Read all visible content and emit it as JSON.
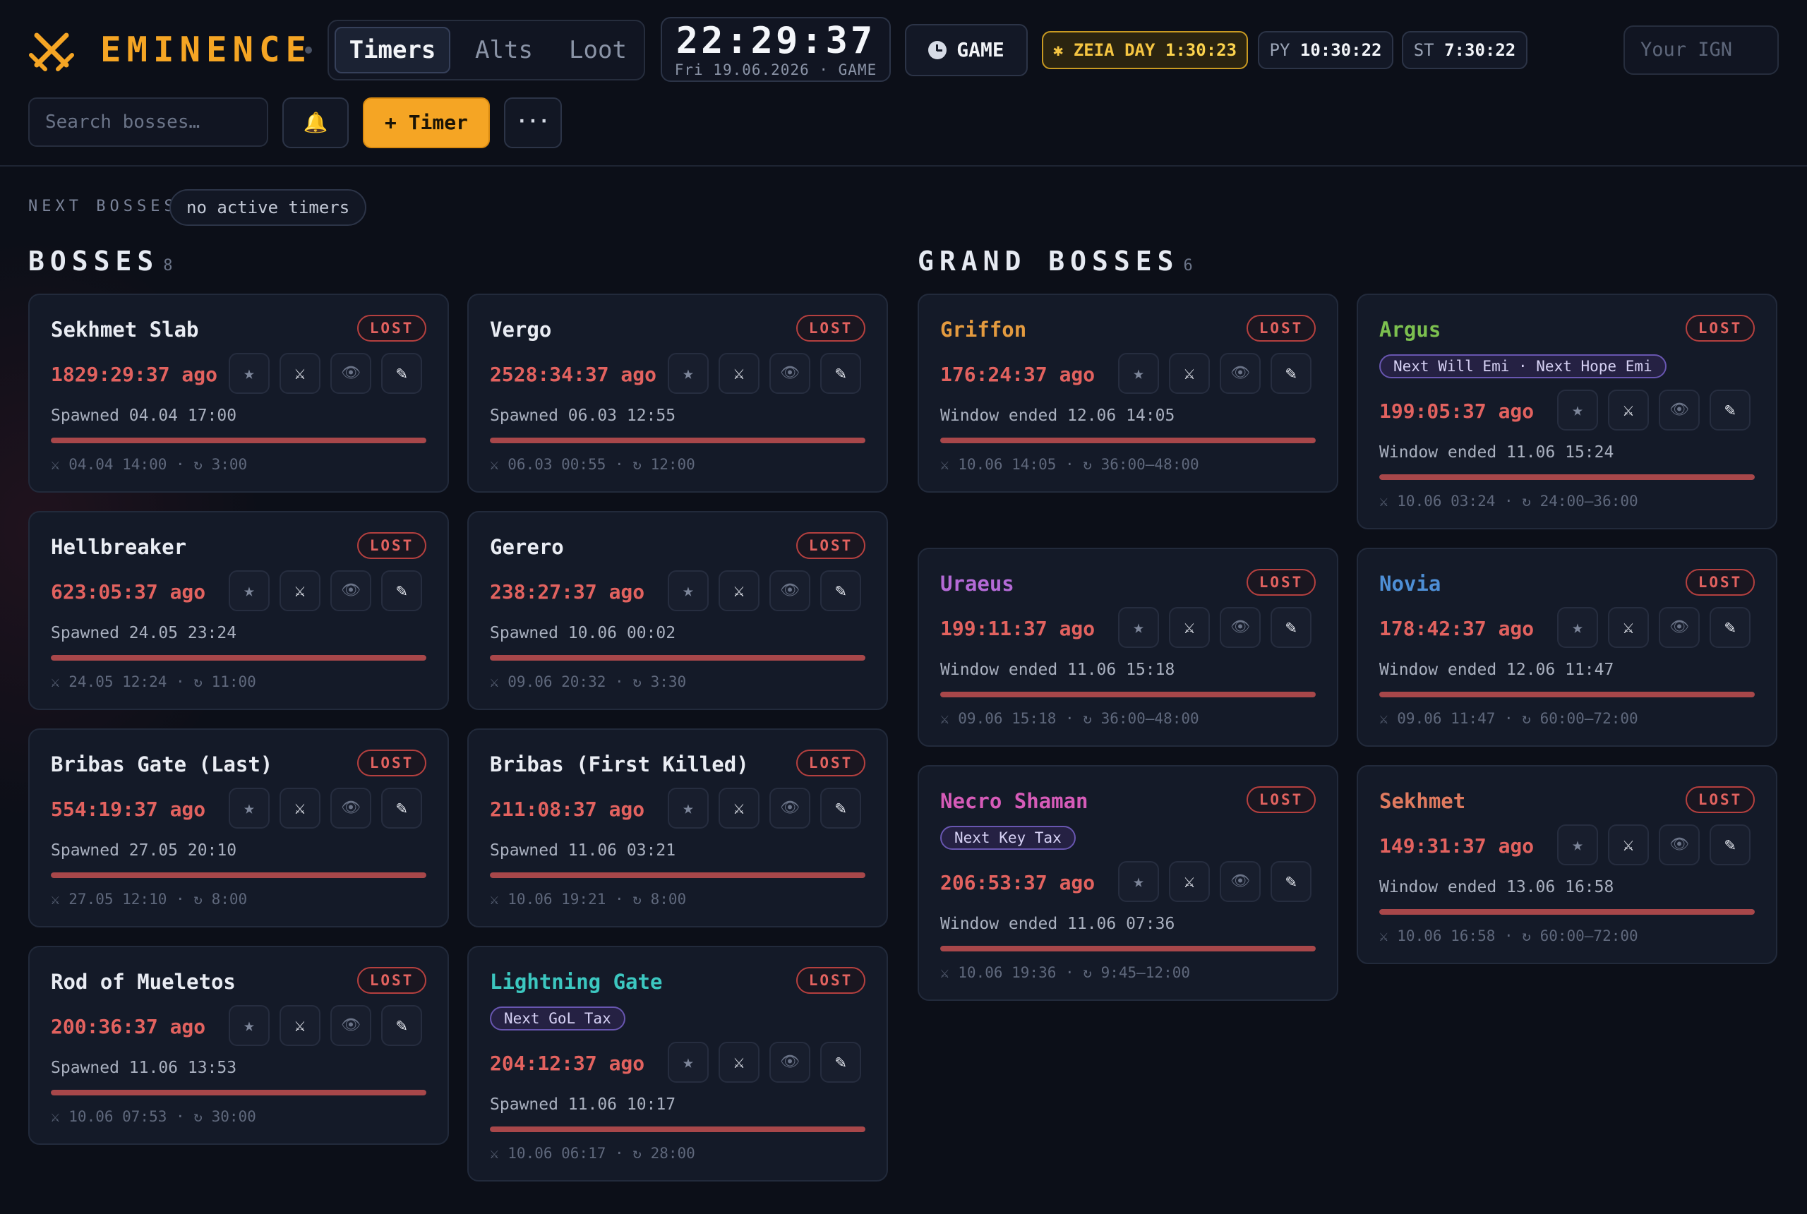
{
  "header": {
    "brand": "EMINENCE",
    "tabs": [
      "Timers",
      "Alts",
      "Loot"
    ],
    "clock_time": "22:29:37",
    "clock_date": "Fri 19.06.2026 · GAME",
    "game_icon": "clock-icon",
    "game_label": "GAME",
    "zeia_label": "✱ ZEIA DAY",
    "zeia_value": "1:30:23",
    "py_label": "PY",
    "py_value": "10:30:22",
    "st_label": "ST",
    "st_value": "7:30:22",
    "ign_placeholder": "Your IGN",
    "search_placeholder": "Search bosses…",
    "bell_icon": "🔔",
    "add_timer_label": "+ Timer",
    "more_label": "···"
  },
  "next": {
    "label": "NEXT BOSSES",
    "chip": "no active timers"
  },
  "bosses": {
    "title": "BOSSES",
    "count": "8",
    "items": [
      {
        "name": "Sekhmet Slab",
        "status": "LOST",
        "ago": "1829:29:37 ago",
        "line": "Spawned 04.04 17:00",
        "foot": "⚔ 04.04 14:00 · ↻ 3:00",
        "progress": 1.0
      },
      {
        "name": "Vergo",
        "status": "LOST",
        "ago": "2528:34:37 ago",
        "line": "Spawned 06.03 12:55",
        "foot": "⚔ 06.03 00:55 · ↻ 12:00",
        "progress": 1.0
      },
      {
        "name": "Hellbreaker",
        "status": "LOST",
        "ago": "623:05:37 ago",
        "line": "Spawned 24.05 23:24",
        "foot": "⚔ 24.05 12:24 · ↻ 11:00",
        "progress": 1.0
      },
      {
        "name": "Gerero",
        "status": "LOST",
        "ago": "238:27:37 ago",
        "line": "Spawned 10.06 00:02",
        "foot": "⚔ 09.06 20:32 · ↻ 3:30",
        "progress": 1.0
      },
      {
        "name": "Bribas Gate (Last)",
        "status": "LOST",
        "ago": "554:19:37 ago",
        "line": "Spawned 27.05 20:10",
        "foot": "⚔ 27.05 12:10 · ↻ 8:00",
        "progress": 1.0
      },
      {
        "name": "Bribas (First Killed)",
        "status": "LOST",
        "ago": "211:08:37 ago",
        "line": "Spawned 11.06 03:21",
        "foot": "⚔ 10.06 19:21 · ↻ 8:00",
        "progress": 1.0
      },
      {
        "name": "Rod of Mueletos",
        "status": "LOST",
        "ago": "200:36:37 ago",
        "line": "Spawned 11.06 13:53",
        "foot": "⚔ 10.06 07:53 · ↻ 30:00",
        "progress": 1.0
      },
      {
        "name": "Lightning Gate",
        "status": "LOST",
        "tag": "Next GoL Tax",
        "ago": "204:12:37 ago",
        "line": "Spawned 11.06 10:17",
        "foot": "⚔ 10.06 06:17 · ↻ 28:00",
        "progress": 1.0
      }
    ]
  },
  "grand": {
    "title": "GRAND BOSSES",
    "count": "6",
    "items": [
      {
        "name": "Griffon",
        "status": "LOST",
        "ago": "176:24:37 ago",
        "line": "Window ended 12.06 14:05",
        "foot": "⚔ 10.06 14:05 · ↻ 36:00–48:00",
        "progress": 1.0
      },
      {
        "name": "Argus",
        "status": "LOST",
        "tag": "Next Will Emi · Next Hope Emi",
        "ago": "199:05:37 ago",
        "line": "Window ended 11.06 15:24",
        "foot": "⚔ 10.06 03:24 · ↻ 24:00–36:00",
        "progress": 1.0
      },
      {
        "name": "Uraeus",
        "status": "LOST",
        "ago": "199:11:37 ago",
        "line": "Window ended 11.06 15:18",
        "foot": "⚔ 09.06 15:18 · ↻ 36:00–48:00",
        "progress": 1.0
      },
      {
        "name": "Novia",
        "status": "LOST",
        "ago": "178:42:37 ago",
        "line": "Window ended 12.06 11:47",
        "foot": "⚔ 09.06 11:47 · ↻ 60:00–72:00",
        "progress": 1.0
      },
      {
        "name": "Necro Shaman",
        "status": "LOST",
        "tag": "Next Key Tax",
        "ago": "206:53:37 ago",
        "line": "Window ended 11.06 07:36",
        "foot": "⚔ 10.06 19:36 · ↻ 9:45–12:00",
        "progress": 1.0
      },
      {
        "name": "Sekhmet",
        "status": "LOST",
        "ago": "149:31:37 ago",
        "line": "Window ended 13.06 16:58",
        "foot": "⚔ 10.06 16:58 · ↻ 60:00–72:00",
        "progress": 1.0
      }
    ]
  },
  "actions": {
    "star_icon": "★",
    "sword_icon": "⚔",
    "eye_icon": "👁",
    "edit_icon": "✎"
  },
  "colors": {
    "accent": "#f5a524",
    "lost": "#e2625f",
    "griffon": "#e39a3f",
    "argus": "#7cc04f",
    "uraeus": "#b46ad6",
    "novia": "#4e8fd6",
    "necro_shaman": "#d65bb8",
    "sekhmet": "#e07a5f",
    "lightning_gate": "#3cc7c0"
  }
}
